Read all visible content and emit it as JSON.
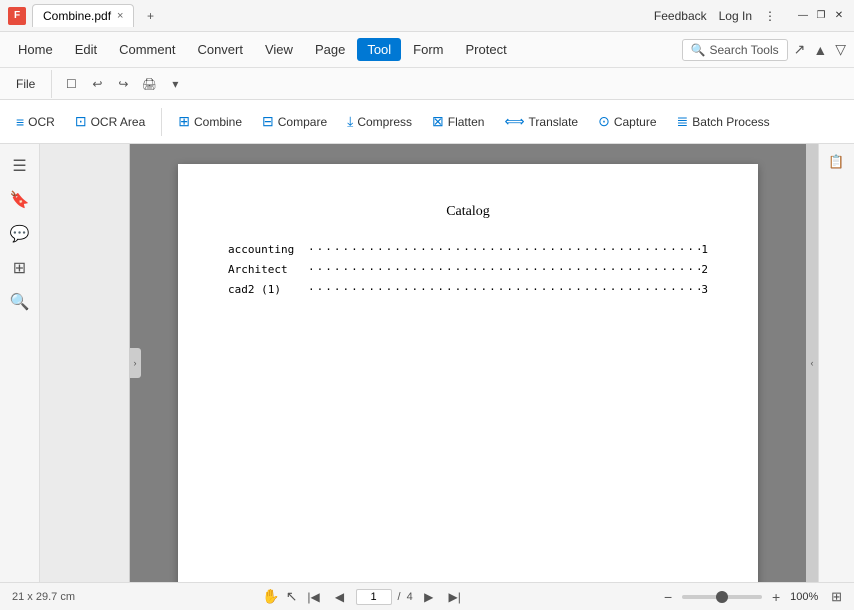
{
  "titlebar": {
    "app_icon": "F",
    "tab_title": "Combine.pdf",
    "tab_close": "×",
    "tab_add": "+",
    "feedback_label": "Feedback",
    "login_label": "Log In",
    "more_label": "⋮",
    "minimize_label": "—",
    "restore_label": "❐",
    "close_label": "✕"
  },
  "menubar": {
    "items": [
      {
        "label": "Home",
        "active": false
      },
      {
        "label": "Edit",
        "active": false
      },
      {
        "label": "Comment",
        "active": false
      },
      {
        "label": "Convert",
        "active": false
      },
      {
        "label": "View",
        "active": false
      },
      {
        "label": "Page",
        "active": false
      },
      {
        "label": "Tool",
        "active": true
      },
      {
        "label": "Form",
        "active": false
      },
      {
        "label": "Protect",
        "active": false
      }
    ],
    "search_placeholder": "Search Tools"
  },
  "filetoolbar": {
    "file_label": "File",
    "icons": [
      "☐",
      "↩",
      "↪",
      "🖨",
      "▾"
    ]
  },
  "toolbar": {
    "buttons": [
      {
        "label": "OCR",
        "icon": "≡"
      },
      {
        "label": "OCR Area",
        "icon": "⊡"
      },
      {
        "label": "Combine",
        "icon": "⊞"
      },
      {
        "label": "Compare",
        "icon": "⊟"
      },
      {
        "label": "Compress",
        "icon": "⤓"
      },
      {
        "label": "Flatten",
        "icon": "⊠"
      },
      {
        "label": "Translate",
        "icon": "⟺"
      },
      {
        "label": "Capture",
        "icon": "⊙"
      },
      {
        "label": "Batch Process",
        "icon": "≣"
      }
    ]
  },
  "sidebar": {
    "icons": [
      "☰",
      "🔖",
      "💬",
      "⊞",
      "🔍"
    ]
  },
  "pdf": {
    "title": "Catalog",
    "rows": [
      {
        "label": "accounting",
        "dots": "·····················································································",
        "page": "1"
      },
      {
        "label": "Architect",
        "dots": "·····················································································",
        "page": "2"
      },
      {
        "label": "cad2 (1)",
        "dots": "·····················································································",
        "page": "3"
      }
    ]
  },
  "statusbar": {
    "dimensions": "21 x 29.7 cm",
    "page_current": "1",
    "page_total": "4",
    "zoom_value": "100%"
  }
}
